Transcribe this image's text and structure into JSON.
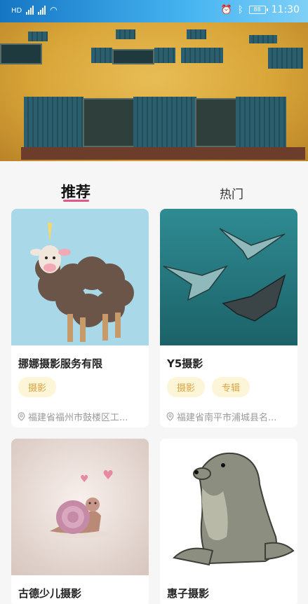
{
  "status_bar": {
    "network_left": "HD",
    "time": "11:30",
    "battery": "88"
  },
  "tabs": [
    {
      "label": "推荐",
      "active": true
    },
    {
      "label": "热门",
      "active": false
    }
  ],
  "cards": [
    {
      "title": "挪娜摄影服务有限",
      "tags": [
        "摄影"
      ],
      "address": "福建省福州市鼓楼区工...",
      "image": "sheep-illustration"
    },
    {
      "title": "Y5摄影",
      "tags": [
        "摄影",
        "专辑"
      ],
      "address": "福建省南平市浦城县名...",
      "image": "manta-rays-illustration"
    },
    {
      "title": "古德少儿摄影",
      "tags": [],
      "address": "",
      "image": "snail-illustration"
    },
    {
      "title": "惠子摄影",
      "tags": [],
      "address": "",
      "image": "seal-illustration"
    }
  ],
  "colors": {
    "accent_pink": "#e0578a",
    "tag_bg": "#fdf5d8",
    "tag_text": "#d9a441"
  }
}
